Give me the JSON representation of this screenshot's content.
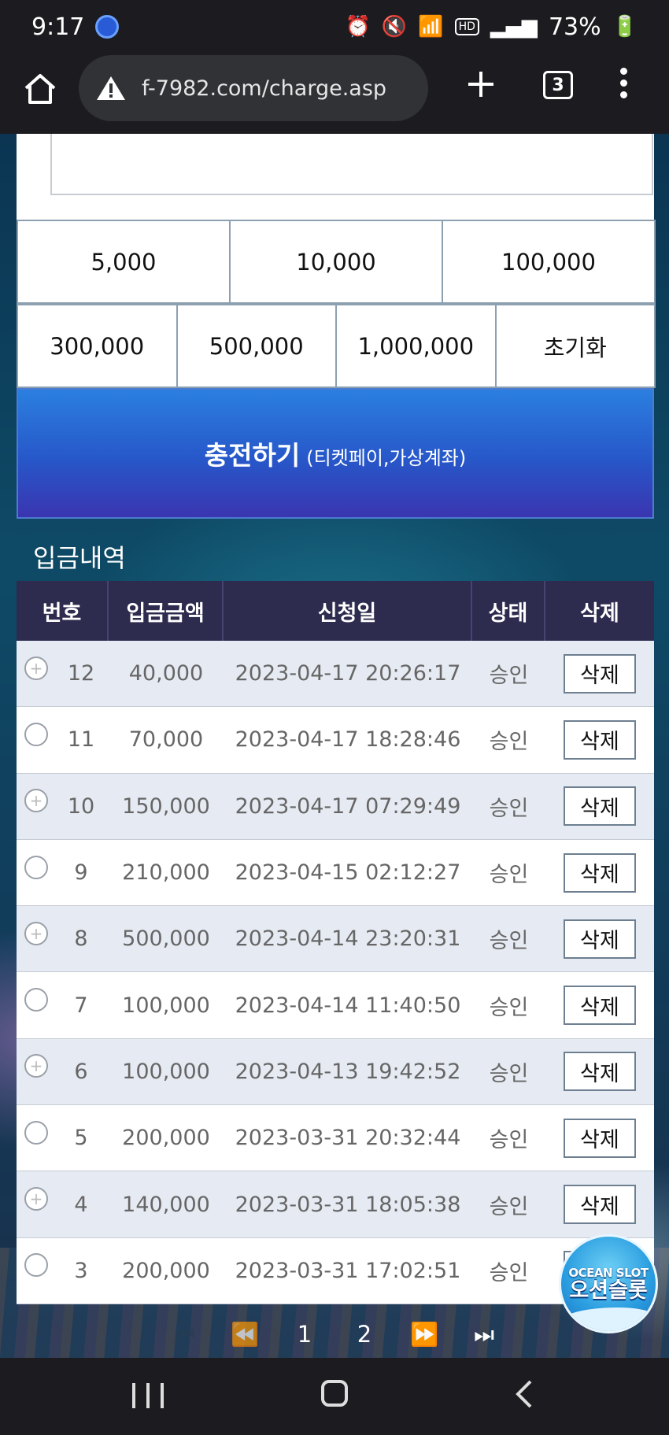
{
  "status_bar": {
    "time": "9:17",
    "battery": "73%",
    "hd_label": "HD",
    "icons": [
      "alarm-icon",
      "mute-icon",
      "wifi-icon",
      "hd-icon",
      "signal-icon",
      "battery-icon"
    ]
  },
  "browser": {
    "url": "f-7982.com/charge.asp",
    "tab_count": "3"
  },
  "amount_buttons": {
    "row1": [
      "5,000",
      "10,000",
      "100,000"
    ],
    "row2": [
      "300,000",
      "500,000",
      "1,000,000",
      "초기화"
    ]
  },
  "charge_button": {
    "label": "충전하기",
    "sublabel": "(티켓페이,가상계좌)"
  },
  "history": {
    "title": "입금내역",
    "columns": [
      "번호",
      "입금금액",
      "신청일",
      "상태",
      "삭제"
    ],
    "delete_label": "삭제",
    "rows": [
      {
        "no": "12",
        "amount": "40,000",
        "date": "2023-04-17 20:26:17",
        "status": "승인"
      },
      {
        "no": "11",
        "amount": "70,000",
        "date": "2023-04-17 18:28:46",
        "status": "승인"
      },
      {
        "no": "10",
        "amount": "150,000",
        "date": "2023-04-17 07:29:49",
        "status": "승인"
      },
      {
        "no": "9",
        "amount": "210,000",
        "date": "2023-04-15 02:12:27",
        "status": "승인"
      },
      {
        "no": "8",
        "amount": "500,000",
        "date": "2023-04-14 23:20:31",
        "status": "승인"
      },
      {
        "no": "7",
        "amount": "100,000",
        "date": "2023-04-14 11:40:50",
        "status": "승인"
      },
      {
        "no": "6",
        "amount": "100,000",
        "date": "2023-04-13 19:42:52",
        "status": "승인"
      },
      {
        "no": "5",
        "amount": "200,000",
        "date": "2023-03-31 20:32:44",
        "status": "승인"
      },
      {
        "no": "4",
        "amount": "140,000",
        "date": "2023-03-31 18:05:38",
        "status": "승인"
      },
      {
        "no": "3",
        "amount": "200,000",
        "date": "2023-03-31 17:02:51",
        "status": "승인"
      }
    ]
  },
  "pagination": {
    "pages": [
      "1",
      "2"
    ],
    "first": "⏮",
    "prev": "⏪",
    "next": "⏩",
    "last": "⏭"
  },
  "badge": {
    "title_en": "OCEAN SLOT",
    "title_ko": "오션슬롯"
  }
}
